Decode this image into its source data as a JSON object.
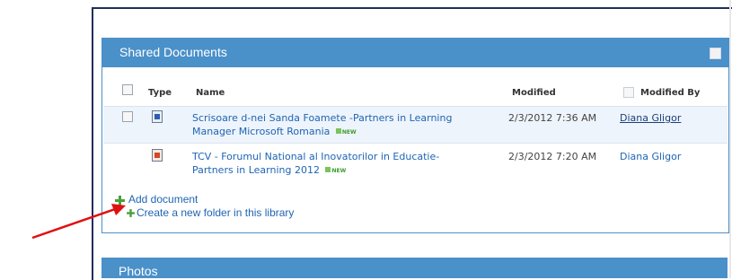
{
  "webpart": {
    "title": "Shared Documents",
    "columns": {
      "type": "Type",
      "name": "Name",
      "modified": "Modified",
      "modified_by": "Modified By"
    },
    "rows": [
      {
        "name_line1": "Scrisoare d-nei Sanda Foamete -Partners in Learning",
        "name_line2": "Manager Microsoft Romania",
        "badge": "NEW",
        "modified": "2/3/2012 7:36 AM",
        "modified_by": "Diana Gligor",
        "icon": "word-doc-icon"
      },
      {
        "name_line1": "TCV - Forumul National al Inovatorilor in Educatie-",
        "name_line2": "Partners in Learning 2012",
        "badge": "NEW",
        "modified": "2/3/2012 7:20 AM",
        "modified_by": "Diana Gligor",
        "icon": "powerpoint-doc-icon"
      }
    ],
    "actions": {
      "add_document": "Add document",
      "create_folder": "Create a new folder in this library"
    }
  },
  "photos": {
    "title": "Photos"
  },
  "colors": {
    "header_blue": "#4a90c9",
    "link_blue": "#1e64b4",
    "arrow_red": "#e01010",
    "plus_green": "#49a03a"
  }
}
